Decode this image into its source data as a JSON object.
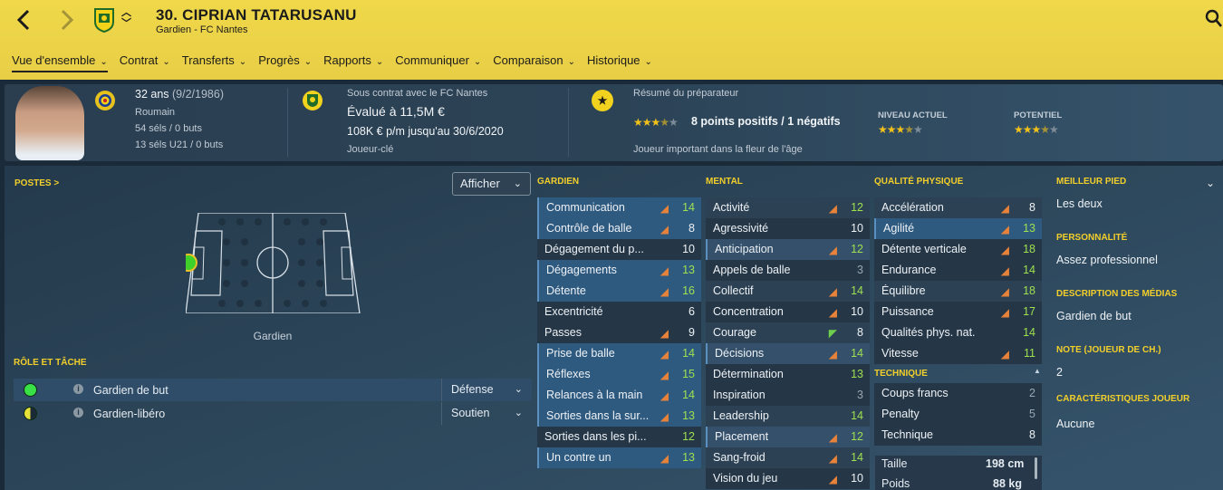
{
  "header": {
    "title": "30. CIPRIAN TATARUSANU",
    "subtitle": "Gardien - FC Nantes",
    "back_icon": "chevron-left-icon",
    "forward_icon": "chevron-right-icon",
    "search_icon": "search-icon"
  },
  "tabs": [
    {
      "label": "Vue d'ensemble"
    },
    {
      "label": "Contrat"
    },
    {
      "label": "Transferts"
    },
    {
      "label": "Progrès"
    },
    {
      "label": "Rapports"
    },
    {
      "label": "Communiquer"
    },
    {
      "label": "Comparaison"
    },
    {
      "label": "Historique"
    }
  ],
  "summary": {
    "age": "32 ans",
    "dob": "(9/2/1986)",
    "nationality": "Roumain",
    "caps": "54 séls / 0 buts",
    "u21_caps": "13 séls U21 / 0 buts",
    "contract_with": "Sous contrat avec le FC Nantes",
    "value": "Évalué à 11,5M €",
    "wage": "108K € p/m jusqu'au 30/6/2020",
    "status": "Joueur-clé",
    "coach_title": "Résumé du préparateur",
    "coach_points": "8 points positifs / 1 négatifs",
    "coach_stars": 3.5,
    "coach_note": "Joueur important dans la fleur de l'âge",
    "current_label": "NIVEAU ACTUEL",
    "current_stars": 3.5,
    "potential_label": "POTENTIEL",
    "potential_stars": 3.5
  },
  "positions": {
    "title": "POSTES >",
    "display_label": "Afficher",
    "position_label": "Gardien"
  },
  "roles": {
    "title": "RÔLE ET TÂCHE",
    "items": [
      {
        "label": "Gardien de but",
        "duty": "Défense"
      },
      {
        "label": "Gardien-libéro",
        "duty": "Soutien"
      }
    ]
  },
  "attributes": {
    "goalkeeping": {
      "title": "GARDIEN",
      "items": [
        {
          "name": "Communication",
          "value": "14"
        },
        {
          "name": "Contrôle de balle",
          "value": "8"
        },
        {
          "name": "Dégagement du p...",
          "value": "10"
        },
        {
          "name": "Dégagements",
          "value": "13"
        },
        {
          "name": "Détente",
          "value": "16"
        },
        {
          "name": "Excentricité",
          "value": "6"
        },
        {
          "name": "Passes",
          "value": "9"
        },
        {
          "name": "Prise de balle",
          "value": "14"
        },
        {
          "name": "Réflexes",
          "value": "15"
        },
        {
          "name": "Relances à la main",
          "value": "14"
        },
        {
          "name": "Sorties dans la sur...",
          "value": "13"
        },
        {
          "name": "Sorties dans les pi...",
          "value": "12"
        },
        {
          "name": "Un contre un",
          "value": "13"
        }
      ]
    },
    "mental": {
      "title": "MENTAL",
      "items": [
        {
          "name": "Activité",
          "value": "12"
        },
        {
          "name": "Agressivité",
          "value": "10"
        },
        {
          "name": "Anticipation",
          "value": "12"
        },
        {
          "name": "Appels de balle",
          "value": "3"
        },
        {
          "name": "Collectif",
          "value": "14"
        },
        {
          "name": "Concentration",
          "value": "10"
        },
        {
          "name": "Courage",
          "value": "8"
        },
        {
          "name": "Décisions",
          "value": "14"
        },
        {
          "name": "Détermination",
          "value": "13"
        },
        {
          "name": "Inspiration",
          "value": "3"
        },
        {
          "name": "Leadership",
          "value": "14"
        },
        {
          "name": "Placement",
          "value": "12"
        },
        {
          "name": "Sang-froid",
          "value": "14"
        },
        {
          "name": "Vision du jeu",
          "value": "10"
        }
      ]
    },
    "physical": {
      "title": "QUALITÉ PHYSIQUE",
      "items": [
        {
          "name": "Accélération",
          "value": "8"
        },
        {
          "name": "Agilité",
          "value": "13"
        },
        {
          "name": "Détente verticale",
          "value": "18"
        },
        {
          "name": "Endurance",
          "value": "14"
        },
        {
          "name": "Équilibre",
          "value": "18"
        },
        {
          "name": "Puissance",
          "value": "17"
        },
        {
          "name": "Qualités phys. nat.",
          "value": "14"
        },
        {
          "name": "Vitesse",
          "value": "11"
        }
      ]
    },
    "technical": {
      "title": "TECHNIQUE",
      "items": [
        {
          "name": "Coups francs",
          "value": "2"
        },
        {
          "name": "Penalty",
          "value": "5"
        },
        {
          "name": "Technique",
          "value": "8"
        }
      ]
    },
    "body": {
      "height_label": "Taille",
      "height": "198 cm",
      "weight_label": "Poids",
      "weight": "88 kg"
    }
  },
  "info": {
    "foot_title": "MEILLEUR PIED",
    "foot": "Les deux",
    "personality_title": "PERSONNALITÉ",
    "personality": "Assez professionnel",
    "media_title": "DESCRIPTION DES MÉDIAS",
    "media": "Gardien de but",
    "rating_title": "NOTE (JOUEUR DE CH.)",
    "rating": "2",
    "traits_title": "CARACTÉRISTIQUES JOUEUR",
    "traits": "Aucune"
  }
}
